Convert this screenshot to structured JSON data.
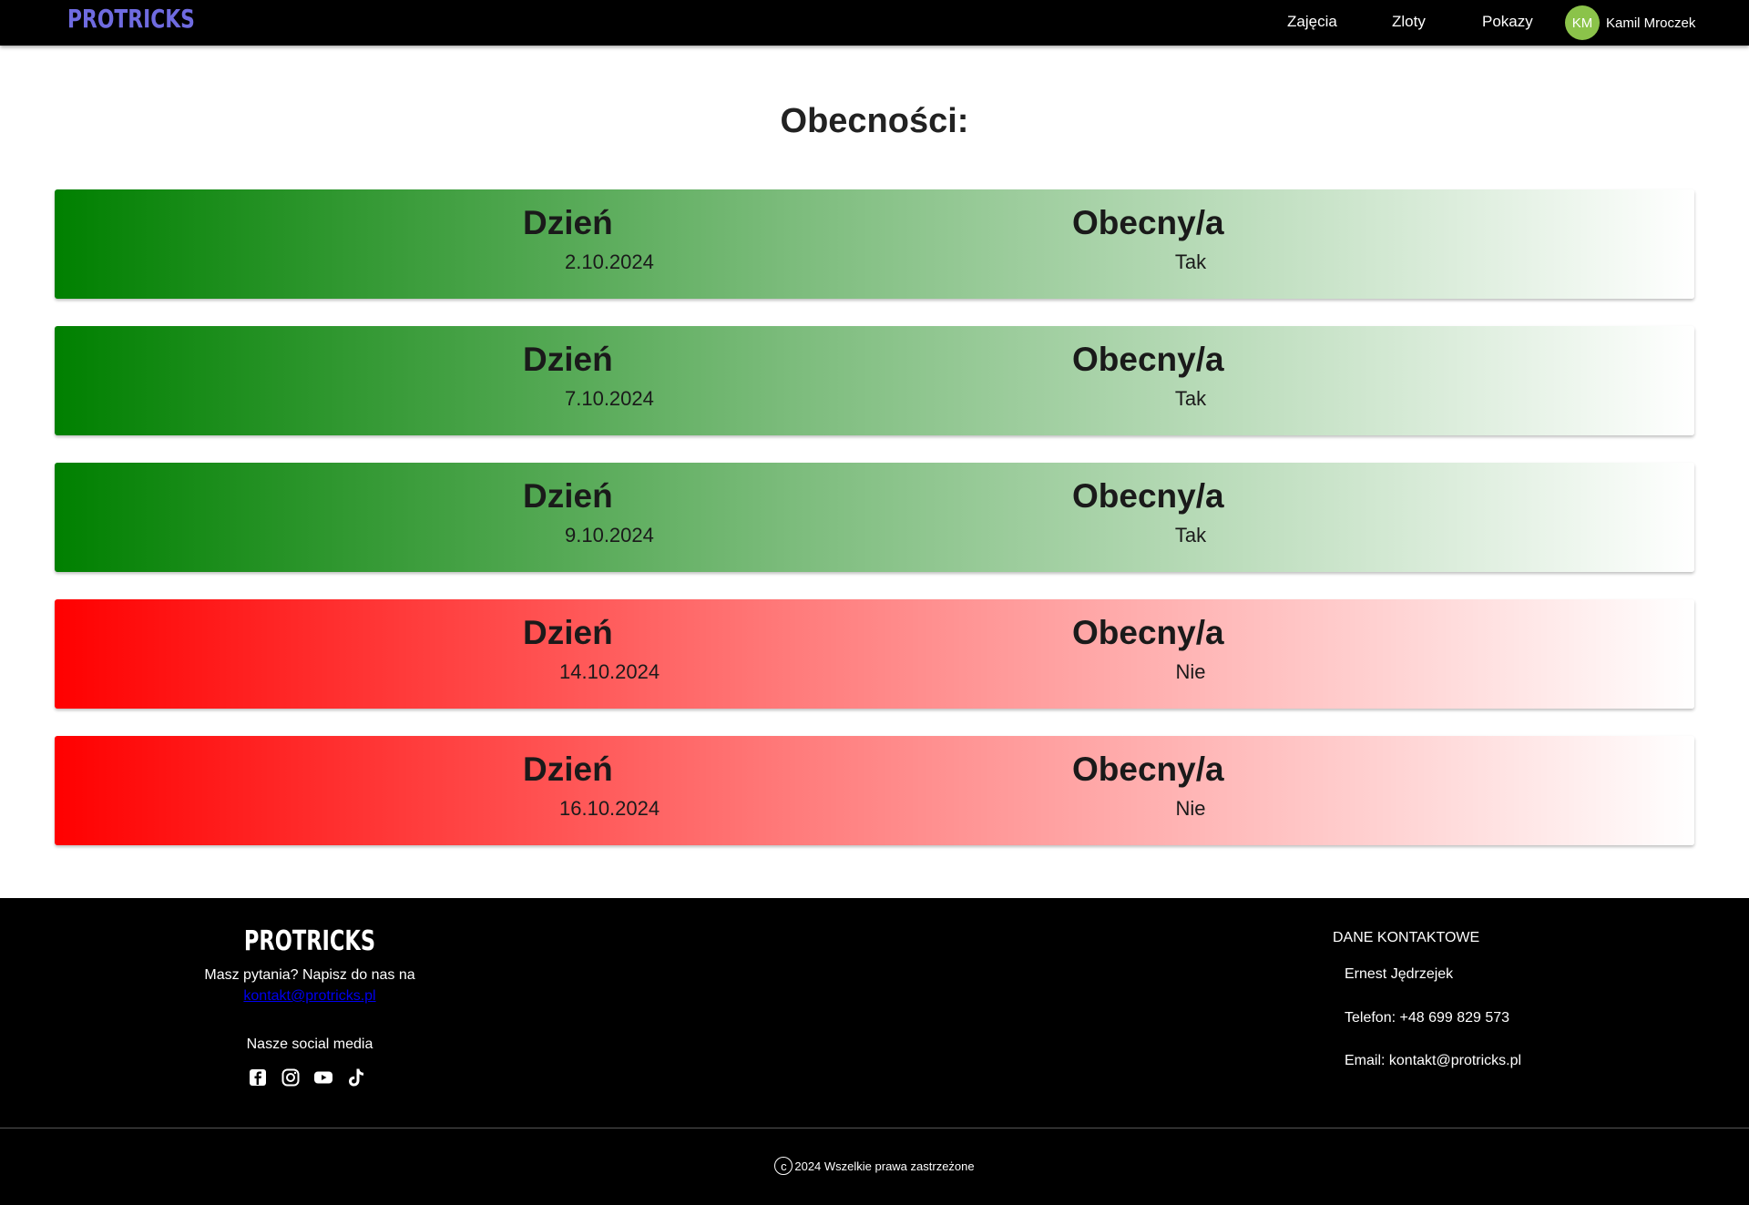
{
  "navbar": {
    "logo": "PROTRICKS",
    "links": [
      "Zajęcia",
      "Zloty",
      "Pokazy"
    ],
    "user": {
      "initials": "KM",
      "name": "Kamil Mroczek"
    }
  },
  "main": {
    "title": "Obecności:",
    "day_label": "Dzień",
    "present_label": "Obecny/a",
    "records": [
      {
        "date": "2.10.2024",
        "present": "Tak"
      },
      {
        "date": "7.10.2024",
        "present": "Tak"
      },
      {
        "date": "9.10.2024",
        "present": "Tak"
      },
      {
        "date": "14.10.2024",
        "present": "Nie"
      },
      {
        "date": "16.10.2024",
        "present": "Nie"
      }
    ]
  },
  "colors": {
    "present": "#008000",
    "absent": "#ff0000",
    "logo": "#6f6be0",
    "avatar": "#8bc34a"
  },
  "footer": {
    "logo": "PROTRICKS",
    "question": "Masz pytania? Napisz do nas na",
    "email_link": "kontakt@protricks.pl",
    "social_title": "Nasze social media",
    "social_icons": [
      "facebook-icon",
      "instagram-icon",
      "youtube-icon",
      "tiktok-icon"
    ],
    "contact_title": "DANE KONTAKTOWE",
    "contact_name": "Ernest Jędrzejek",
    "contact_phone": "Telefon: +48 699 829 573",
    "contact_email": "Email: kontakt@protricks.pl",
    "copyright": "2024 Wszelkie prawa zastrzeżone"
  }
}
